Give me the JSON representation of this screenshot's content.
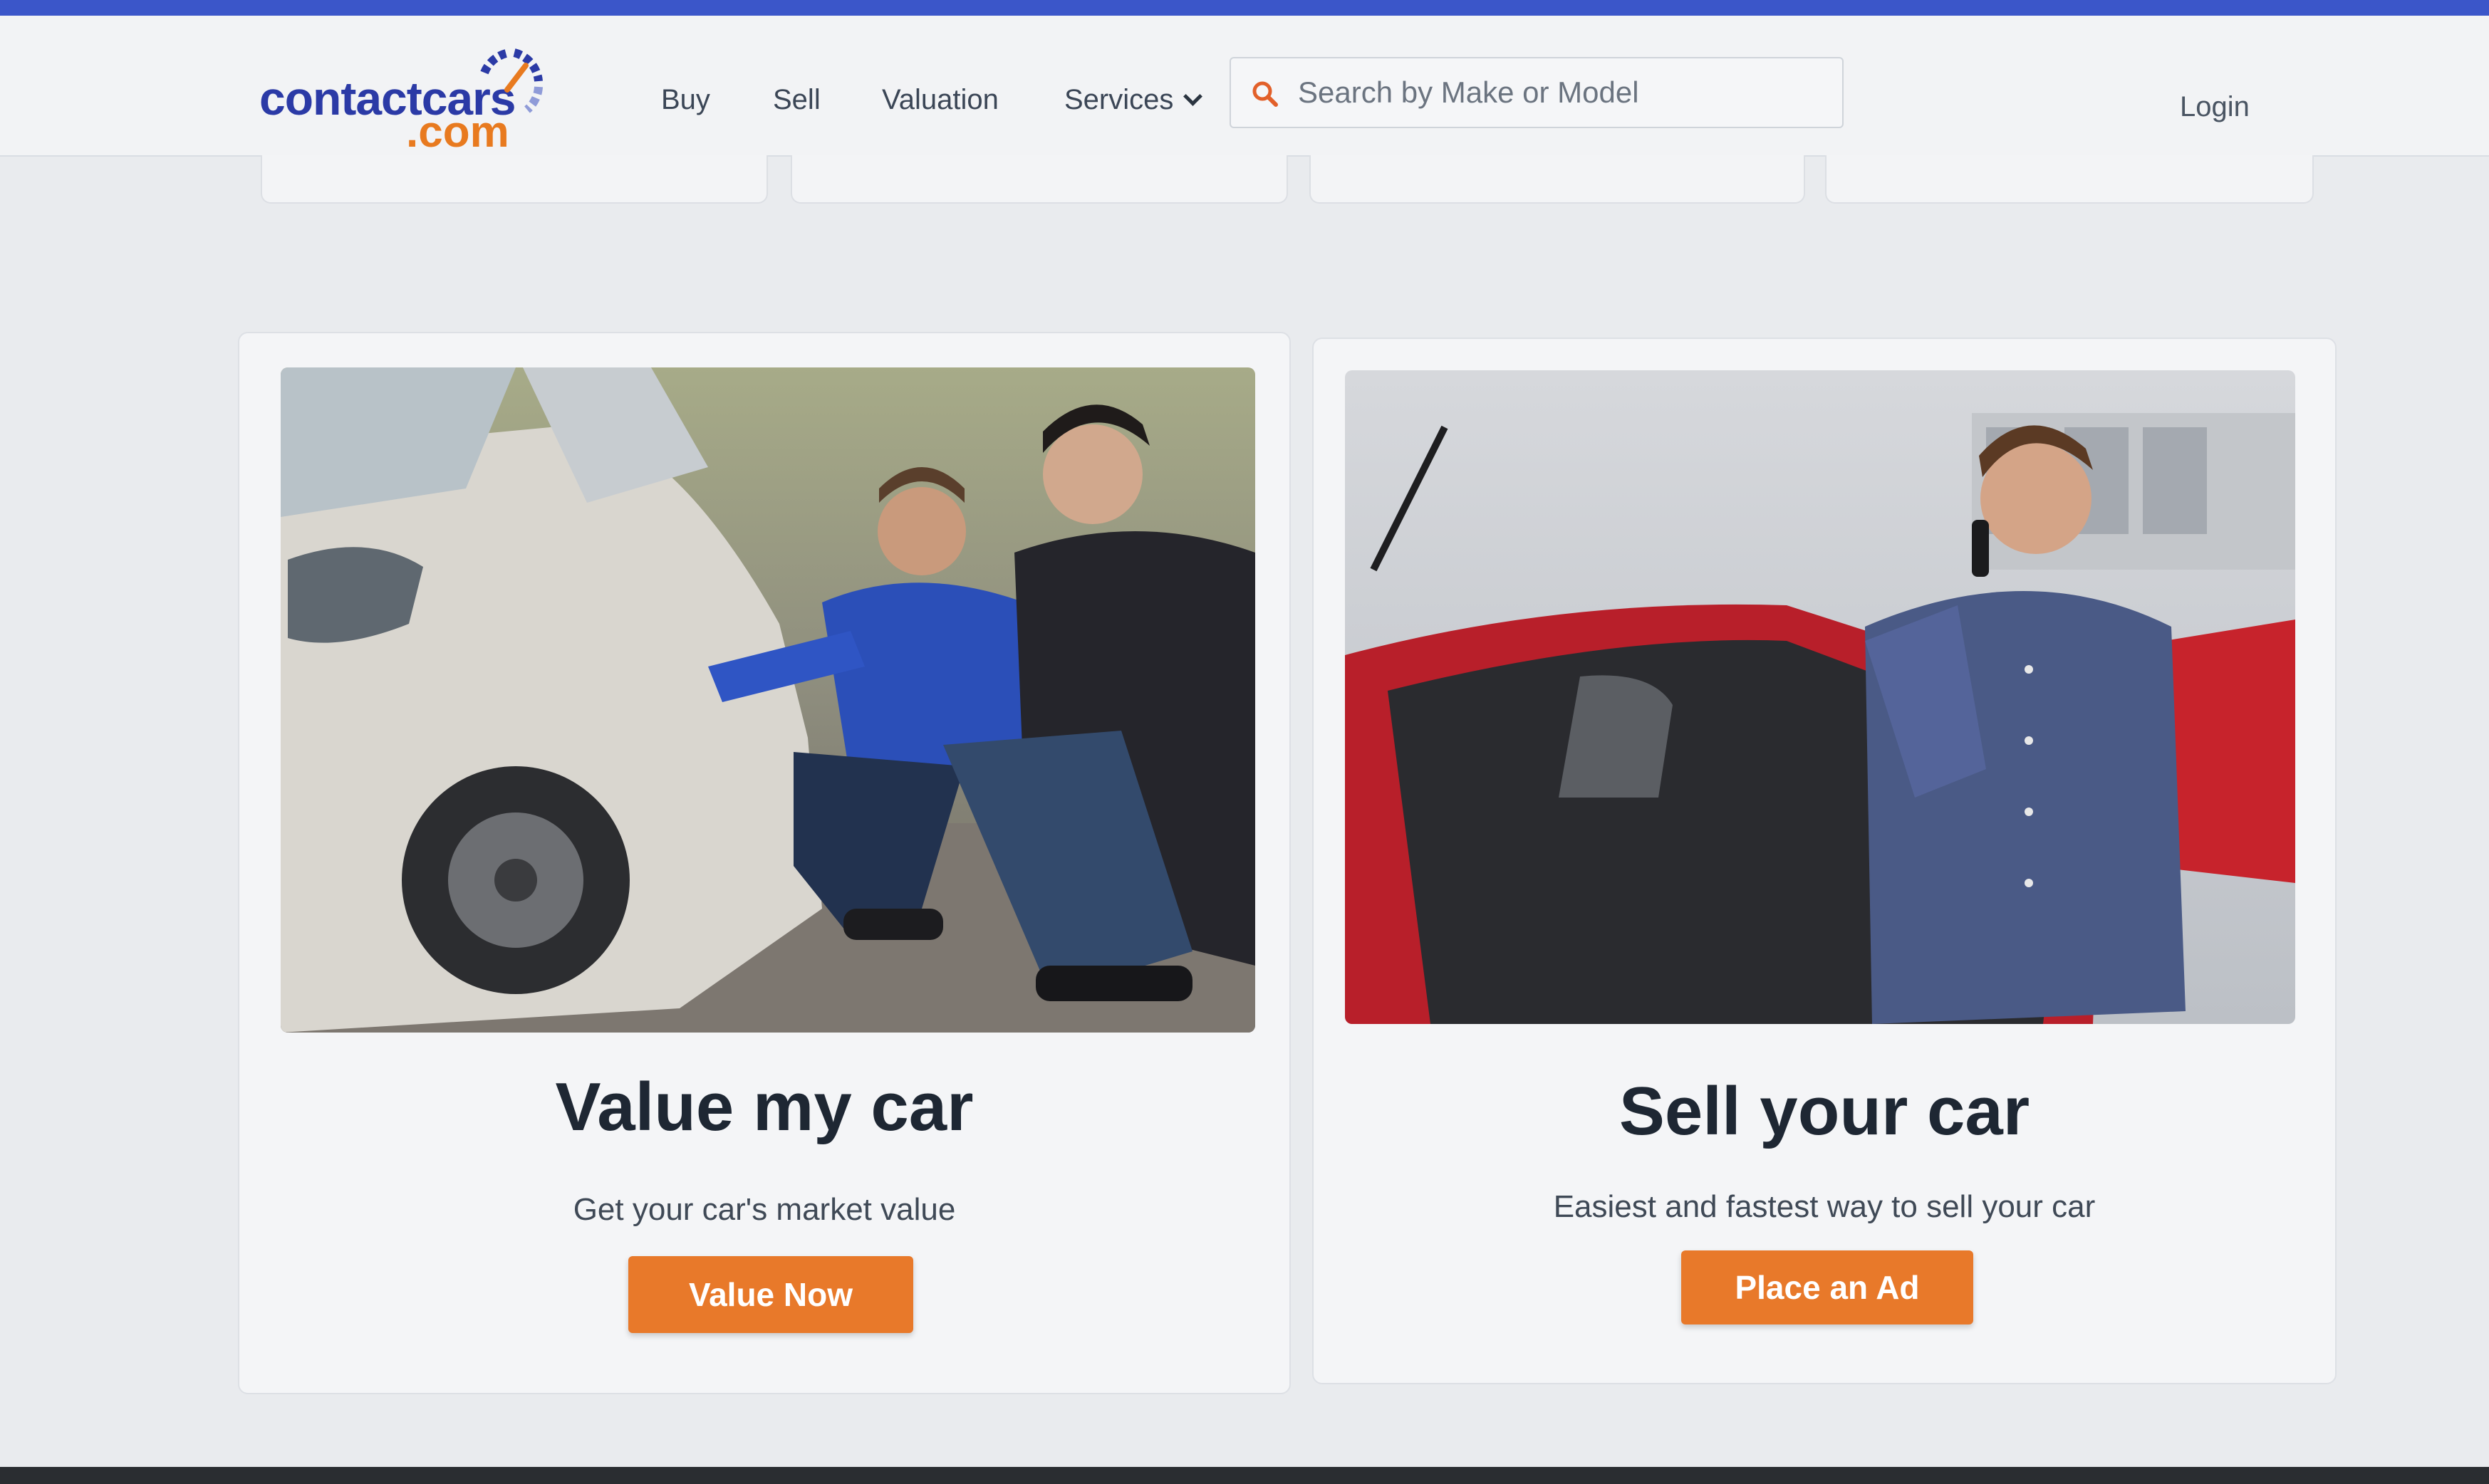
{
  "site": {
    "logo_top": "contactcars",
    "logo_bottom": ".com",
    "brand_blue": "#2b3aa6",
    "brand_orange": "#e87a1f"
  },
  "nav": {
    "buy": "Buy",
    "sell": "Sell",
    "valuation": "Valuation",
    "services": "Services",
    "login": "Login"
  },
  "search": {
    "placeholder": "Search by Make or Model"
  },
  "cards": [
    {
      "title": "Value my car",
      "subtitle": "Get your car's market value",
      "button": "Value Now"
    },
    {
      "title": "Sell your car",
      "subtitle": "Easiest and fastest way to sell your car",
      "button": "Place an Ad"
    }
  ],
  "colors": {
    "accent": "#e8792a",
    "top_strip": "#3b56c9"
  }
}
